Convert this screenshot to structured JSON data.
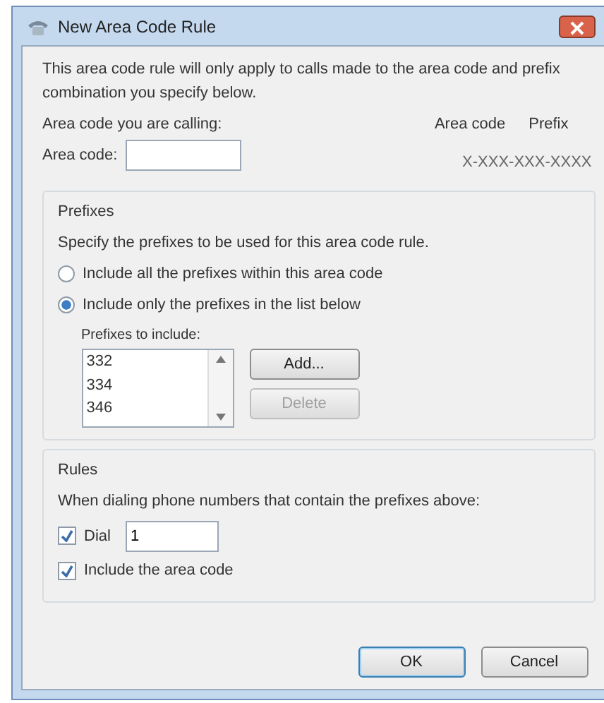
{
  "window": {
    "title": "New Area Code Rule"
  },
  "description": "This area code rule will only apply to calls made to the area code and prefix combination you specify below.",
  "area_code": {
    "label": "Area code you are calling:",
    "field_label": "Area code:"
  },
  "format": {
    "area_code_label": "Area code",
    "prefix_label": "Prefix",
    "pattern": "X-XXX-XXX-XXXX"
  },
  "prefixes": {
    "legend": "Prefixes",
    "instruction": "Specify the prefixes to be used for this area code rule.",
    "radios": [
      {
        "label": "Include all the prefixes within this area code",
        "selected": false
      },
      {
        "label": "Include only the prefixes in the list below",
        "selected": true
      }
    ],
    "list_label": "Prefixes to include:",
    "items": [
      "332",
      "334",
      "346"
    ],
    "buttons": [
      {
        "label": "Add...",
        "disabled": false
      },
      {
        "label": "Delete",
        "disabled": true
      }
    ]
  },
  "rules": {
    "legend": "Rules",
    "instruction": "When dialing phone numbers that contain the prefixes above:",
    "options": [
      {
        "kind": "field",
        "label": "Dial",
        "checked": true,
        "value": "1"
      },
      {
        "kind": "plain",
        "label": "Include the area code",
        "checked": true
      }
    ]
  },
  "buttons": [
    {
      "label": "OK",
      "default": true
    },
    {
      "label": "Cancel",
      "default": false
    }
  ]
}
